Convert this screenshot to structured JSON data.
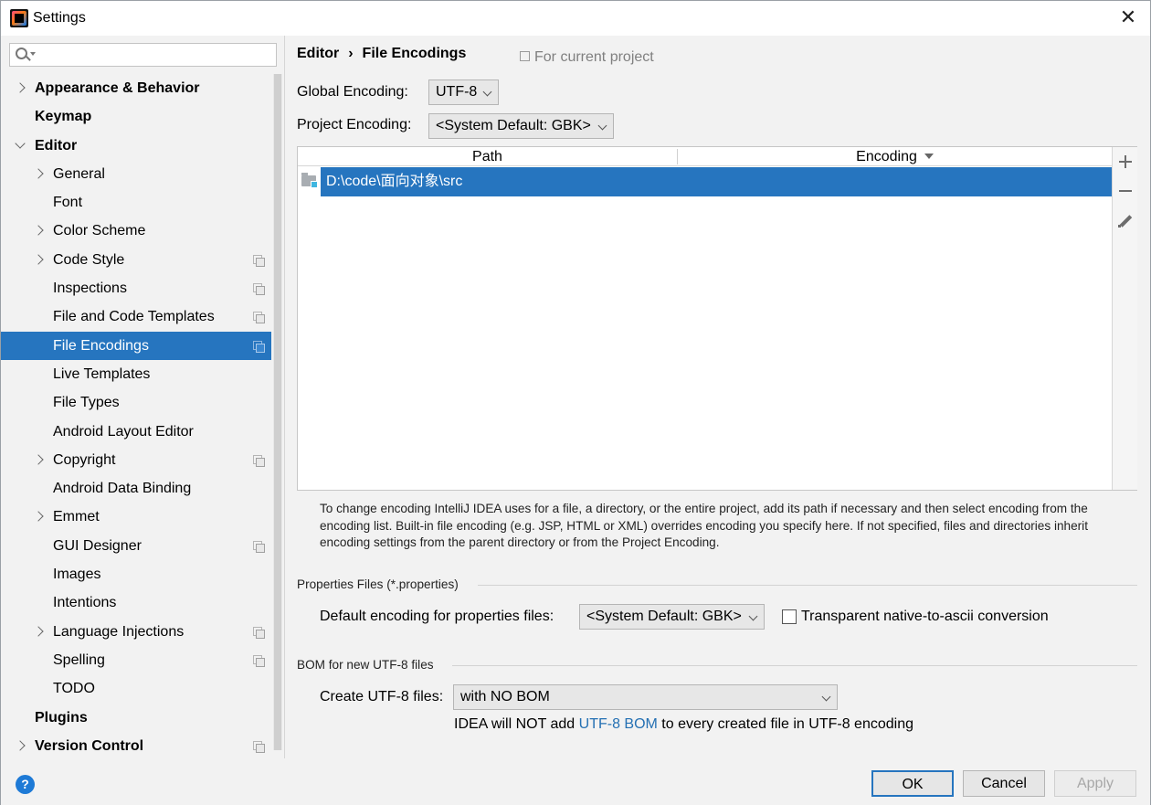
{
  "window": {
    "title": "Settings"
  },
  "sidebar": {
    "search_placeholder": "",
    "items": [
      {
        "label": "Appearance & Behavior",
        "bold": true,
        "chevron": "collapsed"
      },
      {
        "label": "Keymap",
        "bold": true
      },
      {
        "label": "Editor",
        "bold": true,
        "chevron": "expanded"
      },
      {
        "label": "General",
        "chevron": "collapsed"
      },
      {
        "label": "Font"
      },
      {
        "label": "Color Scheme",
        "chevron": "collapsed"
      },
      {
        "label": "Code Style",
        "chevron": "collapsed",
        "project_scoped": true
      },
      {
        "label": "Inspections",
        "project_scoped": true
      },
      {
        "label": "File and Code Templates",
        "project_scoped": true
      },
      {
        "label": "File Encodings",
        "selected": true,
        "project_scoped": true
      },
      {
        "label": "Live Templates"
      },
      {
        "label": "File Types"
      },
      {
        "label": "Android Layout Editor"
      },
      {
        "label": "Copyright",
        "chevron": "collapsed",
        "project_scoped": true
      },
      {
        "label": "Android Data Binding"
      },
      {
        "label": "Emmet",
        "chevron": "collapsed"
      },
      {
        "label": "GUI Designer",
        "project_scoped": true
      },
      {
        "label": "Images"
      },
      {
        "label": "Intentions"
      },
      {
        "label": "Language Injections",
        "chevron": "collapsed",
        "project_scoped": true
      },
      {
        "label": "Spelling",
        "project_scoped": true
      },
      {
        "label": "TODO"
      },
      {
        "label": "Plugins",
        "bold": true
      },
      {
        "label": "Version Control",
        "bold": true,
        "chevron": "collapsed",
        "project_scoped": true
      }
    ]
  },
  "content": {
    "breadcrumb": {
      "parent": "Editor",
      "separator": "›",
      "current": "File Encodings"
    },
    "scope_label": "For current project",
    "global_encoding": {
      "label": "Global Encoding:",
      "value": "UTF-8"
    },
    "project_encoding": {
      "label": "Project Encoding:",
      "value": "<System Default: GBK>"
    },
    "table": {
      "columns": [
        "Path",
        "Encoding"
      ],
      "rows": [
        {
          "path": "D:\\code\\面向对象\\src",
          "encoding": ""
        }
      ]
    },
    "help_text": "To change encoding IntelliJ IDEA uses for a file, a directory, or the entire project, add its path if necessary and then select encoding from the encoding list. Built-in file encoding (e.g. JSP, HTML or XML) overrides encoding you specify here. If not specified, files and directories inherit encoding settings from the parent directory or from the Project Encoding.",
    "properties_group": {
      "title": "Properties Files (*.properties)",
      "default_label": "Default encoding for properties files:",
      "default_value": "<System Default: GBK>",
      "checkbox_label": "Transparent native-to-ascii conversion",
      "checkbox_checked": false
    },
    "bom_group": {
      "title": "BOM for new UTF-8 files",
      "create_label": "Create UTF-8 files:",
      "create_value": "with NO BOM",
      "note_prefix": "IDEA will NOT add ",
      "note_link": "UTF-8 BOM",
      "note_suffix": " to every created file in UTF-8 encoding"
    }
  },
  "footer": {
    "help": "?",
    "ok": "OK",
    "cancel": "Cancel",
    "apply": "Apply"
  },
  "colors": {
    "selection": "#2675bf",
    "link": "#2470b3",
    "help_button": "#1e7ad6"
  }
}
